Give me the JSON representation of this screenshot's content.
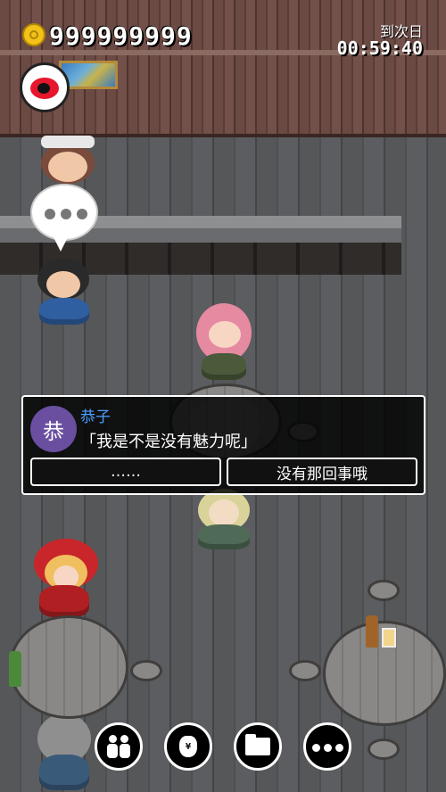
{
  "hud": {
    "gold": "999999999",
    "timer_label": "到次日",
    "timer_value": "00:59:40"
  },
  "dialog": {
    "avatar_char": "恭",
    "speaker": "恭子",
    "line": "「我是不是没有魅力呢」",
    "choices": [
      "……",
      "没有那回事哦"
    ]
  },
  "icons": {
    "coin": "coin-icon",
    "weibo": "weibo-icon",
    "speech": "speech-bubble-icon",
    "people": "people-icon",
    "money_bag": "money-bag-icon",
    "folder": "folder-icon",
    "more": "more-icon"
  },
  "colors": {
    "avatar_bg": "#6a4fa0",
    "speaker_name": "#4aa0ff",
    "coin": "#f2c21a"
  }
}
